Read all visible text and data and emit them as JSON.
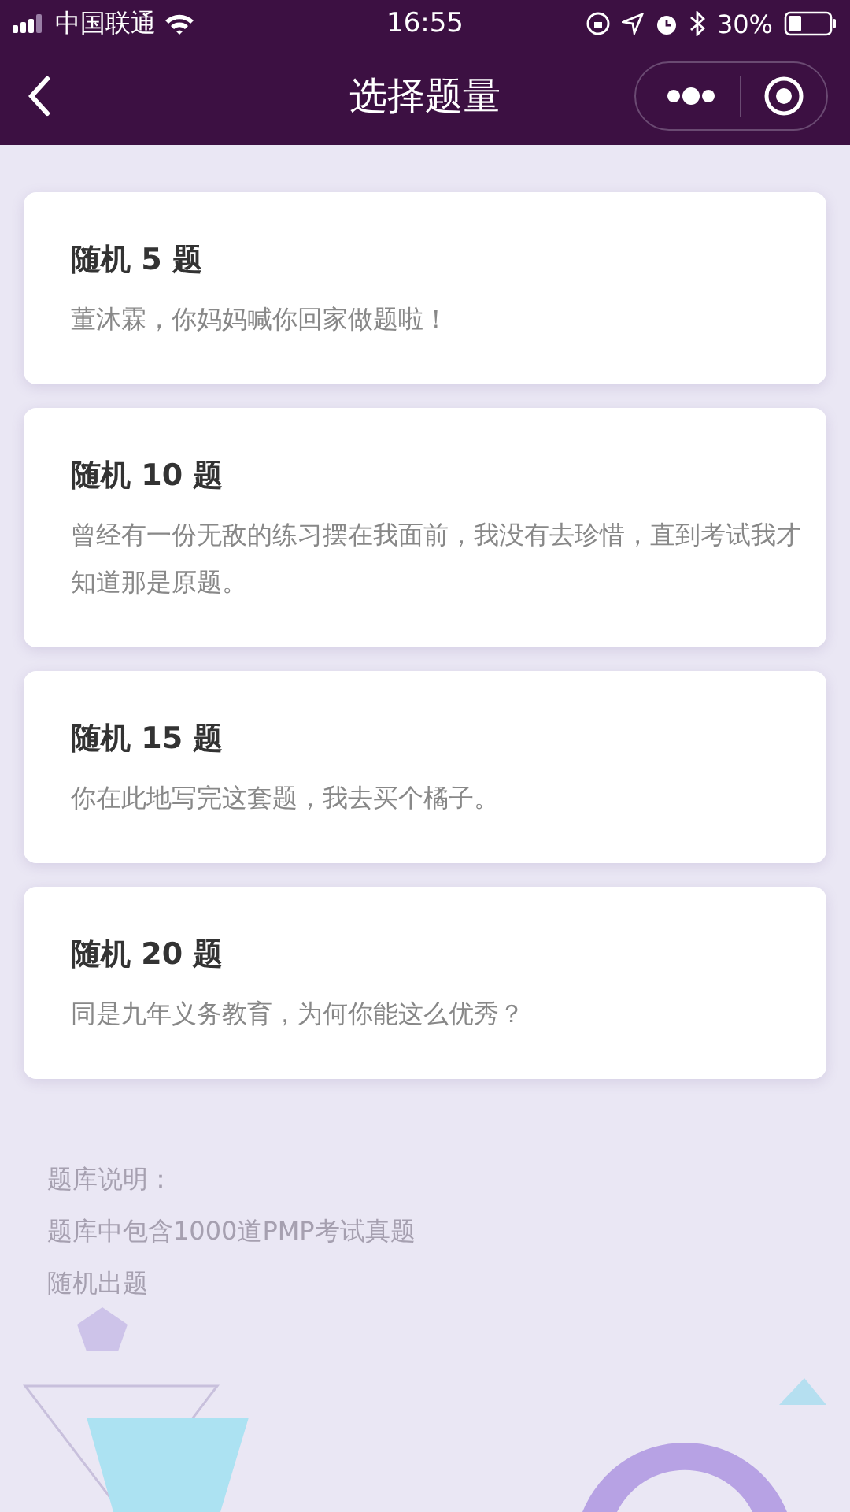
{
  "status_bar": {
    "carrier": "中国联通",
    "time": "16:55",
    "battery": "30%"
  },
  "nav": {
    "title": "选择题量"
  },
  "options": [
    {
      "title": "随机 5 题",
      "subtitle": "董沐霖，你妈妈喊你回家做题啦！"
    },
    {
      "title": "随机 10 题",
      "subtitle": "曾经有一份无敌的练习摆在我面前，我没有去珍惜，直到考试我才知道那是原题。"
    },
    {
      "title": "随机 15 题",
      "subtitle": "你在此地写完这套题，我去买个橘子。"
    },
    {
      "title": "随机 20 题",
      "subtitle": "同是九年义务教育，为何你能这么优秀？"
    }
  ],
  "notes": [
    "题库说明：",
    "题库中包含1000道PMP考试真题",
    "随机出题"
  ]
}
